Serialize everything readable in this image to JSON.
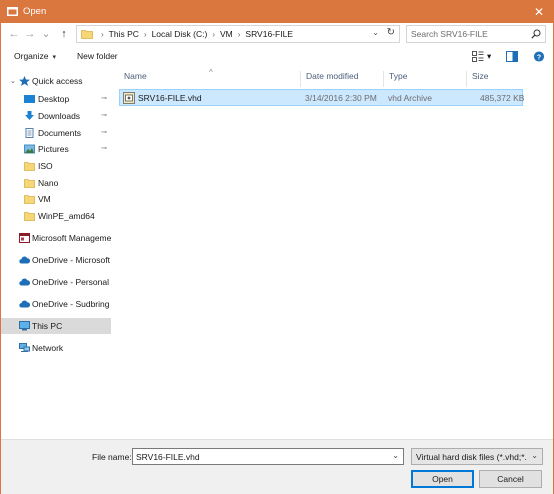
{
  "window": {
    "title": "Open",
    "close_glyph": "✕"
  },
  "nav": {
    "back_glyph": "←",
    "forward_glyph": "→",
    "recent_glyph": "⌄",
    "up_glyph": "↑",
    "breadcrumbs": [
      "This PC",
      "Local Disk (C:)",
      "VM",
      "SRV16-FILE"
    ],
    "crumb_separator": "›",
    "dropdown_glyph": "⌄",
    "refresh_glyph": "↻"
  },
  "search": {
    "placeholder": "Search SRV16-FILE"
  },
  "toolbar": {
    "organize_label": "Organize",
    "organize_dd": "▾",
    "new_folder_label": "New folder",
    "view_dd": "▾",
    "help_glyph": "?"
  },
  "sidebar": {
    "quick_access": "Quick access",
    "items": [
      {
        "label": "Desktop",
        "icon": "desktop-icon",
        "pinned": true
      },
      {
        "label": "Downloads",
        "icon": "download-icon",
        "pinned": true
      },
      {
        "label": "Documents",
        "icon": "documents-icon",
        "pinned": true
      },
      {
        "label": "Pictures",
        "icon": "pictures-icon",
        "pinned": true
      },
      {
        "label": "ISO",
        "icon": "folder-icon",
        "pinned": false
      },
      {
        "label": "Nano",
        "icon": "folder-icon",
        "pinned": false
      },
      {
        "label": "VM",
        "icon": "folder-icon",
        "pinned": false
      },
      {
        "label": "WinPE_amd64",
        "icon": "folder-icon",
        "pinned": false
      }
    ],
    "pin_glyph": "📌",
    "microsoft_management": "Microsoft Manageme",
    "onedrive_microsoft": "OneDrive - Microsoft",
    "onedrive_personal": "OneDrive - Personal",
    "onedrive_sudbring": "OneDrive - Sudbring",
    "this_pc": "This PC",
    "network": "Network"
  },
  "file_list": {
    "columns": {
      "name": "Name",
      "date": "Date modified",
      "type": "Type",
      "size": "Size"
    },
    "sort_glyph": "^",
    "rows": [
      {
        "name": "SRV16-FILE.vhd",
        "date": "3/14/2016 2:30 PM",
        "type": "vhd Archive",
        "size": "485,372 KB",
        "selected": true
      }
    ]
  },
  "footer": {
    "file_name_label": "File name:",
    "file_name_value": "SRV16-FILE.vhd",
    "file_type_value": "Virtual hard disk files (*.vhd;*.",
    "dd_glyph": "⌄",
    "open_label": "Open",
    "cancel_label": "Cancel"
  },
  "colors": {
    "titlebar": "#d9773f",
    "selection": "#cce8ff",
    "accent": "#0078d7"
  }
}
